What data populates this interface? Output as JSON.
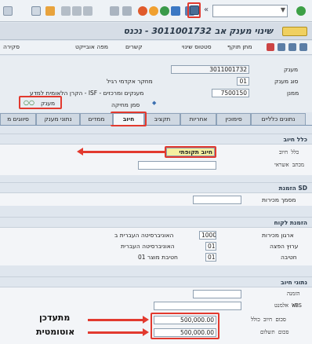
{
  "toolbar": {
    "command_field": "",
    "nav_arrows": "«"
  },
  "title": {
    "text": "שינוי מענק אב 3011001732 - נכנס"
  },
  "appbar": {
    "items": [
      "סטטוס שינוי",
      "קשרים",
      "מפה אובייקט",
      "מתן תוקף",
      "סקירה"
    ]
  },
  "header": {
    "grant_label": "מענק",
    "grant_value": "3011001732",
    "grant_type_label": "סוג מענק",
    "grant_type_value": "01",
    "grant_type_desc": "מחקר אקדמי רגיל",
    "sponsor_label": "ממנן",
    "sponsor_value": "7500150",
    "sponsor_desc": "הקרן הלאומית למדע - ISF - מענקים ומרכזים",
    "lock_label": "סמן מחיקה",
    "status_label": "מענק",
    "status_value": "○○"
  },
  "tabs": [
    "נתונים כלליים",
    "סימוכין",
    "אחריות",
    "תקציב",
    "חיוב",
    "ממדים",
    "נתוני מענק",
    "סיווגים מ"
  ],
  "billing": {
    "section_title": "כלל חיוב",
    "rule_label": "כלל חיוב",
    "rule_value": "חיוב תקופתי",
    "credit_label": "מכתב אשראי",
    "credit_value": ""
  },
  "sd": {
    "section_title": "הזמנת SD",
    "doc_label": "מסמך מכירות",
    "doc_value": ""
  },
  "customer_order": {
    "section_title": "הזמנת לקוח",
    "org_label": "ארגון מכירות",
    "org_value": "1000",
    "org_desc": "האוניברסיטה העברית ב",
    "channel_label": "ערוץ הפצה",
    "channel_value": "01",
    "channel_desc": "האוניברסיטה העברית",
    "division_label": "חטיבה",
    "division_value": "01",
    "division_desc": "חטיבת מוצר 01"
  },
  "billing_data": {
    "section_title": "נתוני חיוב",
    "order_label": "הזמנה",
    "order_value": "",
    "wbs_label": "אלמנט WBS",
    "wbs_value": "",
    "total_label": "סכום חיוב כולל",
    "total_value": "500,000.00",
    "paid_label": "סכום תשלום",
    "paid_value": "500,000.00"
  },
  "annotations": {
    "updated": "מתעדכן",
    "automatic": "אוטומטית"
  }
}
